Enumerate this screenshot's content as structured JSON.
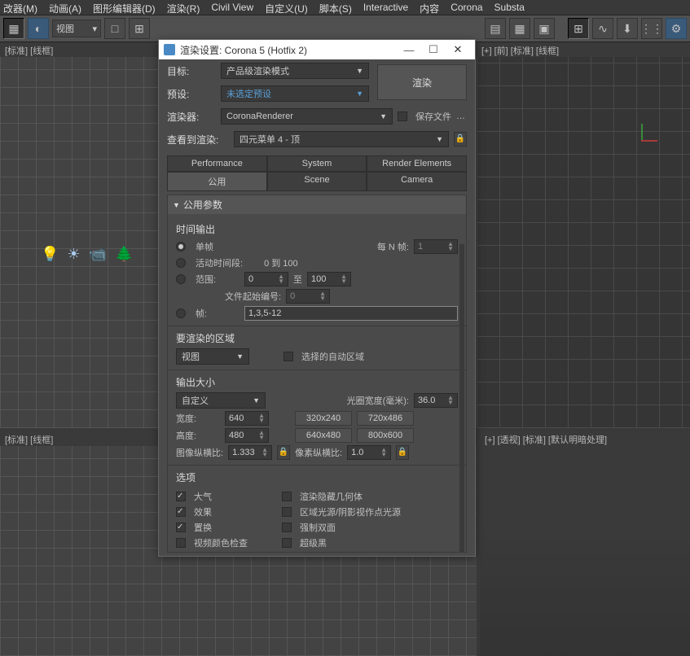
{
  "menu": [
    "改器(M)",
    "动画(A)",
    "图形编辑器(D)",
    "渲染(R)",
    "Civil View",
    "自定义(U)",
    "脚本(S)",
    "Interactive",
    "内容",
    "Corona",
    "Substa"
  ],
  "toolbar": {
    "view_label": "视图"
  },
  "viewports": {
    "tl": "[标准] [线框]",
    "tr": "[+] [前] [标准] [线框]",
    "bl": "[标准] [线框]",
    "br": "[+] [透视] [标准] [默认明暗处理]"
  },
  "dialog": {
    "title": "渲染设置: Corona 5 (Hotfix 2)",
    "target_lbl": "目标:",
    "target_val": "产品级渲染模式",
    "preset_lbl": "预设:",
    "preset_val": "未选定预设",
    "renderer_lbl": "渲染器:",
    "renderer_val": "CoronaRenderer",
    "savefile": "保存文件",
    "viewto_lbl": "查看到渲染:",
    "viewto_val": "四元菜单 4 - 顶",
    "render_btn": "渲染",
    "tabs1": [
      "Performance",
      "System",
      "Render Elements"
    ],
    "tabs2": [
      "公用",
      "Scene",
      "Camera"
    ],
    "roll_title": "公用参数",
    "time": {
      "hdr": "时间输出",
      "single": "单帧",
      "every_n": "每 N 帧:",
      "every_n_val": "1",
      "active": "活动时间段:",
      "active_val": "0 到 100",
      "range": "范围:",
      "r_from": "0",
      "r_to_lbl": "至",
      "r_to": "100",
      "file_start": "文件起始编号:",
      "file_start_val": "0",
      "frames": "帧:",
      "frames_val": "1,3,5-12"
    },
    "area": {
      "hdr": "要渲染的区域",
      "val": "视图",
      "auto": "选择的自动区域"
    },
    "size": {
      "hdr": "输出大小",
      "sel": "自定义",
      "aperture_lbl": "光圈宽度(毫米):",
      "aperture_val": "36.0",
      "w_lbl": "宽度:",
      "w_val": "640",
      "h_lbl": "高度:",
      "h_val": "480",
      "p1": "320x240",
      "p2": "720x486",
      "p3": "640x480",
      "p4": "800x600",
      "iar_lbl": "图像纵横比:",
      "iar_val": "1.333",
      "par_lbl": "像素纵横比:",
      "par_val": "1.0"
    },
    "opts": {
      "hdr": "选项",
      "atmos": "大气",
      "effects": "效果",
      "disp": "置换",
      "vcc": "视频颜色检查",
      "hidden": "渲染隐藏几何体",
      "arealights": "区域光源/阴影视作点光源",
      "twosided": "强制双面",
      "superblack": "超级黑"
    }
  }
}
